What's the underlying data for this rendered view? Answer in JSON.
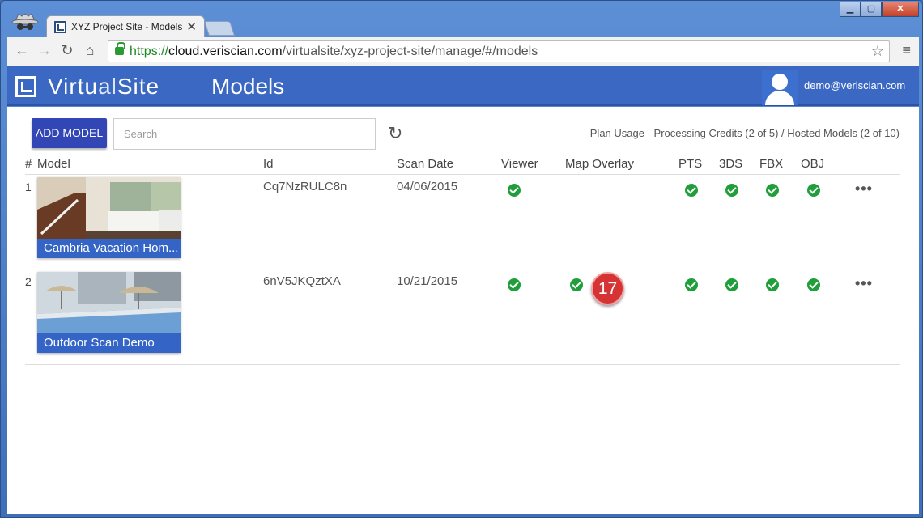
{
  "browser": {
    "tab_title": "XYZ Project Site - Models",
    "tab_close": "✕",
    "url_scheme": "https://",
    "url_host": "cloud.veriscian.com",
    "url_path": "/virtualsite/xyz-project-site/manage/#/models",
    "window_buttons": {
      "minimize": "▁",
      "maximize": "▢",
      "close": "✕"
    }
  },
  "header": {
    "logo_part1": "Virtu",
    "logo_part2": "al",
    "logo_part3": "Site",
    "page_title": "Models",
    "user_email": "demo@veriscian.com"
  },
  "toolbar": {
    "add_button": "ADD MODEL",
    "search_placeholder": "Search",
    "usage_text": "Plan Usage - Processing Credits (2 of 5) / Hosted Models (2 of 10)"
  },
  "table": {
    "columns": {
      "num": "#",
      "model": "Model",
      "id": "Id",
      "scan_date": "Scan Date",
      "viewer": "Viewer",
      "map_overlay": "Map Overlay",
      "pts": "PTS",
      "threeds": "3DS",
      "fbx": "FBX",
      "obj": "OBJ"
    },
    "rows": [
      {
        "num": "1",
        "name": "Cambria Vacation Hom...",
        "id": "Cq7NzRULC8n",
        "scan_date": "04/06/2015",
        "viewer": true,
        "map_overlay": false,
        "pts": true,
        "threeds": true,
        "fbx": true,
        "obj": true,
        "more": "•••"
      },
      {
        "num": "2",
        "name": "Outdoor Scan Demo",
        "id": "6nV5JKQztXA",
        "scan_date": "10/21/2015",
        "viewer": true,
        "map_overlay": true,
        "pts": true,
        "threeds": true,
        "fbx": true,
        "obj": true,
        "more": "•••"
      }
    ]
  },
  "step_badge": "17",
  "colors": {
    "header_blue": "#3b68c2",
    "button_blue": "#3346b5",
    "check_green": "#1f9e3a",
    "badge_red": "#d63434"
  }
}
